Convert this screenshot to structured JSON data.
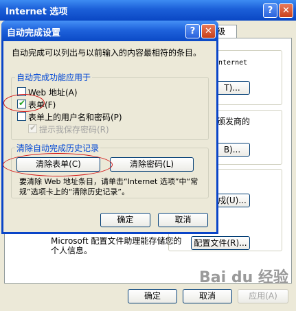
{
  "back_window": {
    "title": "Internet 选项",
    "help_glyph": "?",
    "close_glyph": "✕",
    "tab_visible_label": "级",
    "home_text_fragment": "nternet",
    "home_button_fragment": "T)...",
    "publisher_fragment": "颁发商的",
    "cert_button_fragment": "B)...",
    "autocomplete_button_fragment": "戍(U)...",
    "profile_text": "Microsoft 配置文件助理能存储您的个人信息。",
    "profile_button": "配置文件(R)...",
    "ok_button": "确定",
    "cancel_button": "取消",
    "apply_button": "应用(A)"
  },
  "dialog": {
    "title": "自动完成设置",
    "help_glyph": "?",
    "close_glyph": "✕",
    "description": "自动完成可以列出与以前输入的内容最相符的条目。",
    "apply_group": {
      "title": "自动完成功能应用于",
      "options": [
        {
          "label": "Web 地址(A)",
          "checked": false,
          "enabled": true
        },
        {
          "label": "表单(F)",
          "checked": true,
          "enabled": true
        },
        {
          "label": "表单上的用户名和密码(P)",
          "checked": false,
          "enabled": true
        },
        {
          "label": "提示我保存密码(R)",
          "checked": true,
          "enabled": false
        }
      ]
    },
    "clear_group": {
      "title": "清除自动完成历史记录",
      "clear_forms_button": "清除表单(C)",
      "clear_passwords_button": "清除密码(L)",
      "note": "要清除 Web 地址条目，请单击“Internet 选项”中“常规”选项卡上的“清除历史记录”。"
    },
    "ok_button": "确定",
    "cancel_button": "取消"
  },
  "watermark": "Bai du 经验"
}
